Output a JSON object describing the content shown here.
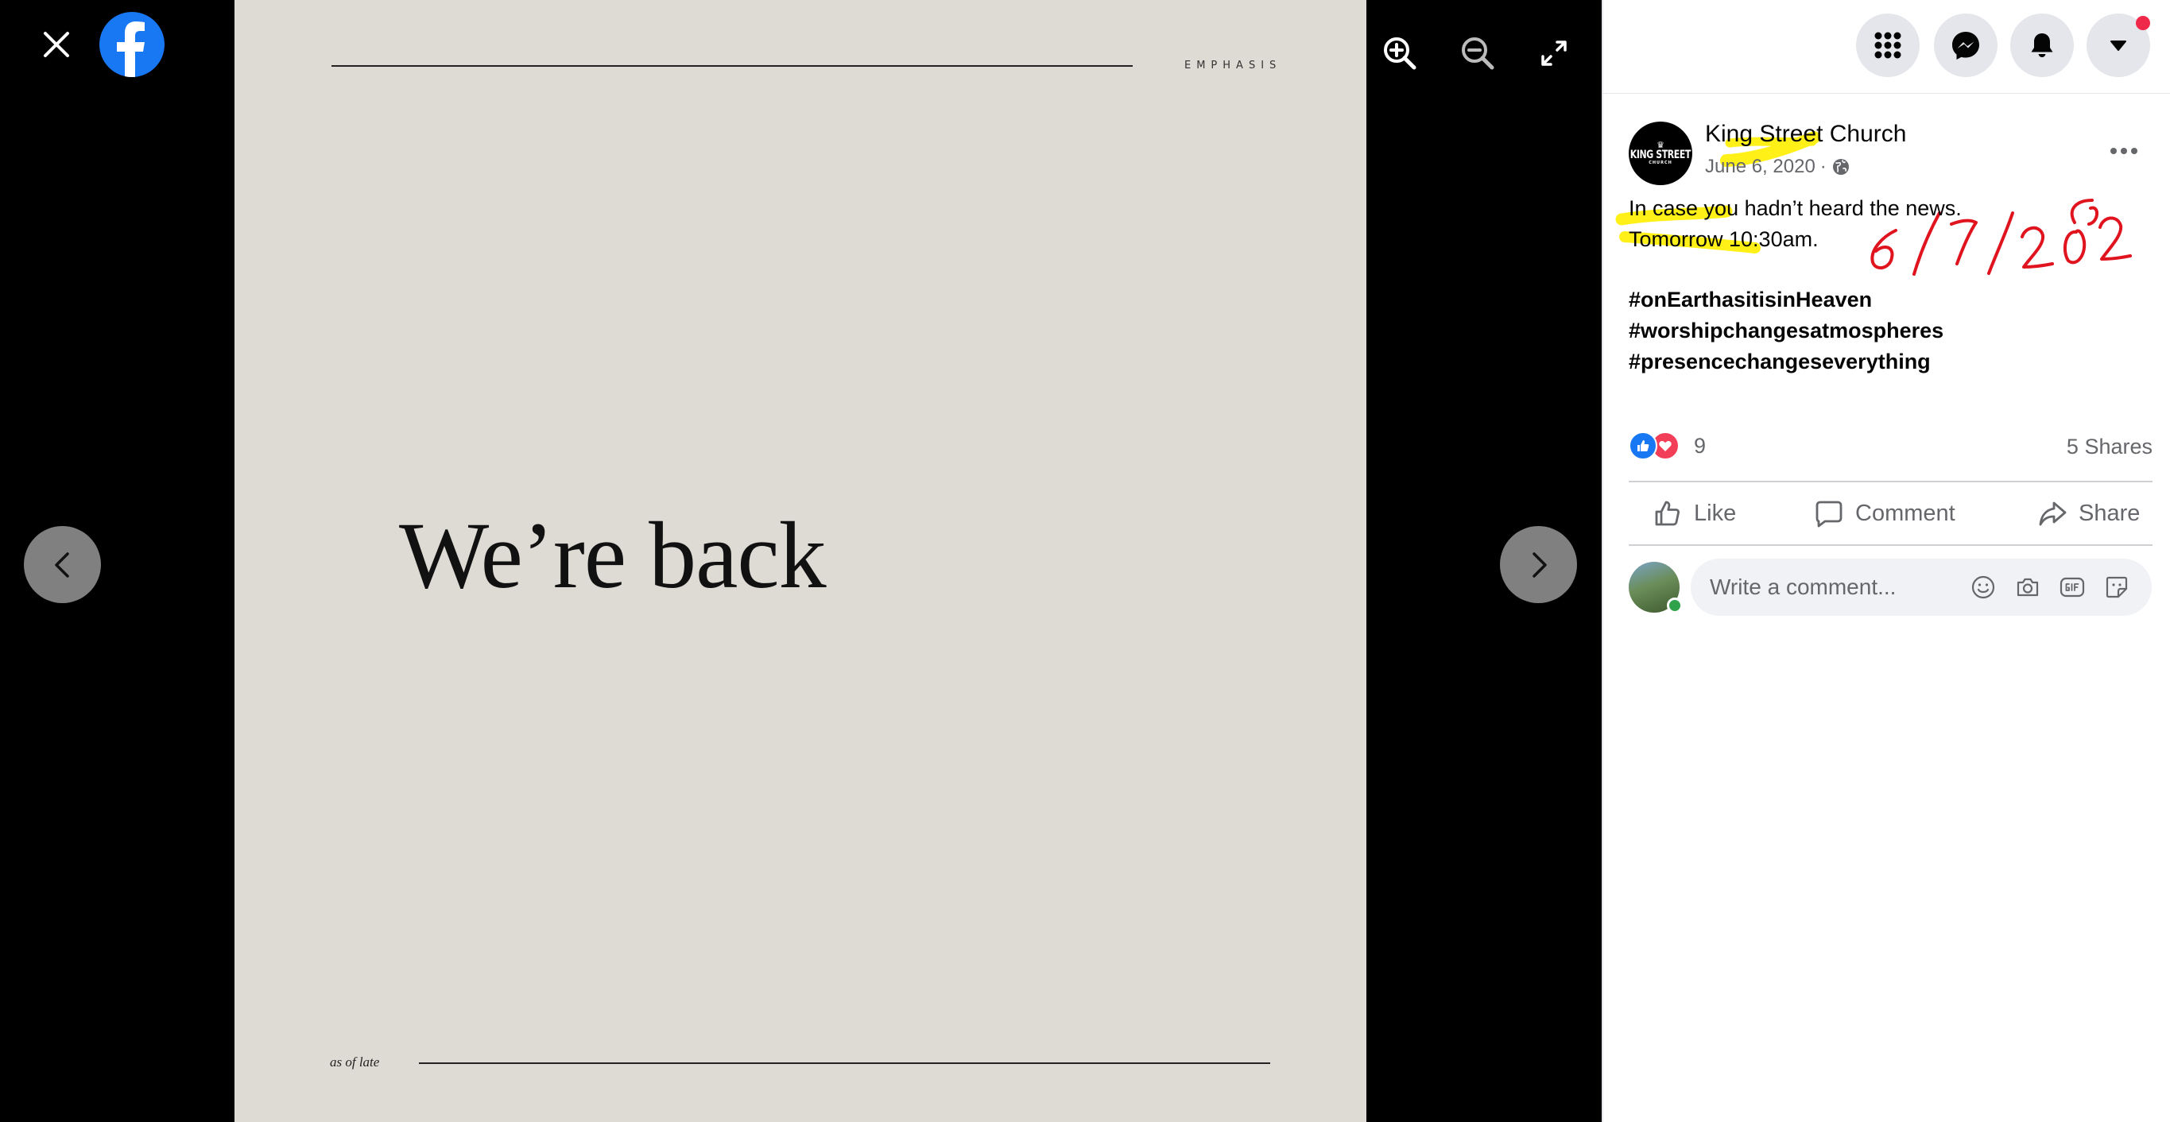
{
  "viewer": {
    "photo": {
      "tag": "EMPHASIS",
      "headline": "We’re back",
      "footer": "as of late"
    }
  },
  "header": {
    "notification_badge_color": "#f02849"
  },
  "post": {
    "page_name": "King Street Church",
    "avatar_logo": {
      "crown": "♛",
      "name": "KING STREET",
      "sub": "CHURCH"
    },
    "date": "June 6, 2020",
    "separator": "·",
    "text": "In case you hadn’t heard the news.\nTomorrow 10:30am.",
    "hashtags": [
      "#onEarthasitisinHeaven",
      "#worshipchangesatmospheres",
      "#presencechangeseverything"
    ],
    "reaction_count": "9",
    "shares": "5 Shares",
    "actions": {
      "like": "Like",
      "comment": "Comment",
      "share": "Share"
    },
    "comment_placeholder": "Write a comment...",
    "handwritten_note": "6/7/2020"
  },
  "colors": {
    "brand": "#1877f2",
    "highlight": "#ffef00",
    "handwriting": "#e0141e"
  }
}
